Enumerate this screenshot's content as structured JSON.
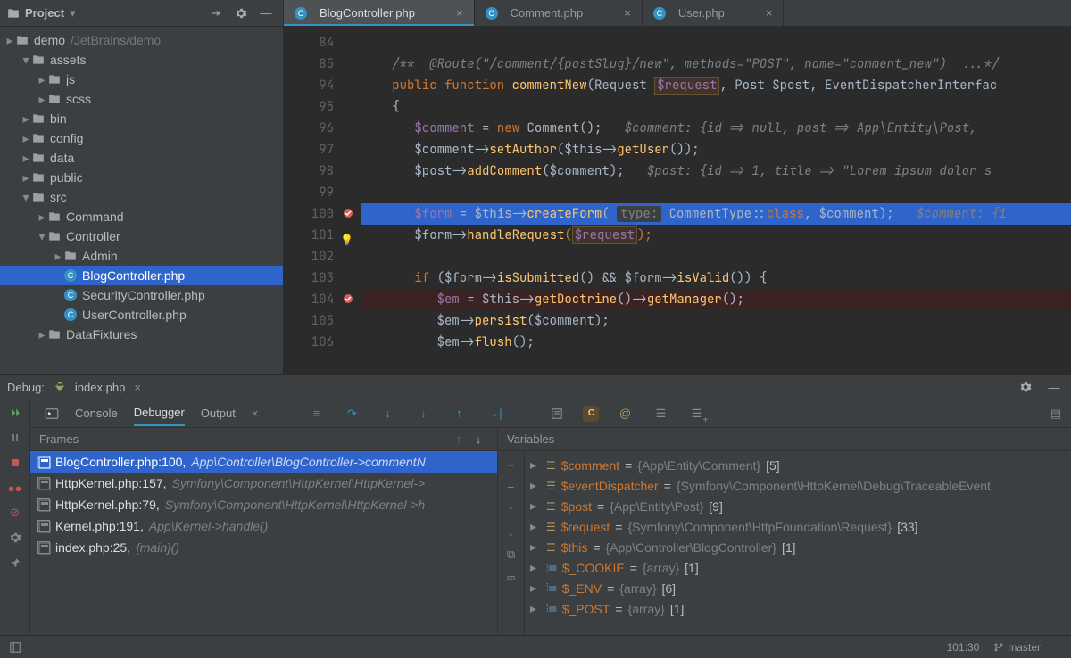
{
  "project": {
    "title": "Project",
    "root": {
      "name": "demo",
      "path": "/JetBrains/demo"
    },
    "tree": [
      {
        "type": "root",
        "name": "demo",
        "path": "/JetBrains/demo",
        "depth": 0
      },
      {
        "type": "folder",
        "name": "assets",
        "depth": 1,
        "expanded": true
      },
      {
        "type": "folder",
        "name": "js",
        "depth": 2,
        "expanded": false
      },
      {
        "type": "folder",
        "name": "scss",
        "depth": 2,
        "expanded": false
      },
      {
        "type": "folder",
        "name": "bin",
        "depth": 1,
        "expanded": false
      },
      {
        "type": "folder",
        "name": "config",
        "depth": 1,
        "expanded": false
      },
      {
        "type": "folder",
        "name": "data",
        "depth": 1,
        "expanded": false
      },
      {
        "type": "folder",
        "name": "public",
        "depth": 1,
        "expanded": false
      },
      {
        "type": "folder",
        "name": "src",
        "depth": 1,
        "expanded": true
      },
      {
        "type": "folder",
        "name": "Command",
        "depth": 2,
        "expanded": false
      },
      {
        "type": "folder",
        "name": "Controller",
        "depth": 2,
        "expanded": true
      },
      {
        "type": "folder",
        "name": "Admin",
        "depth": 3,
        "expanded": false
      },
      {
        "type": "file",
        "name": "BlogController.php",
        "depth": 3,
        "selected": true
      },
      {
        "type": "file",
        "name": "SecurityController.php",
        "depth": 3
      },
      {
        "type": "file",
        "name": "UserController.php",
        "depth": 3
      },
      {
        "type": "folder",
        "name": "DataFixtures",
        "depth": 2,
        "expanded": false
      }
    ]
  },
  "tabs": [
    {
      "label": "BlogController.php",
      "active": true
    },
    {
      "label": "Comment.php",
      "active": false
    },
    {
      "label": "User.php",
      "active": false
    }
  ],
  "editor": {
    "line_numbers": [
      "84",
      "85",
      "94",
      "95",
      "96",
      "97",
      "98",
      "99",
      "100",
      "101",
      "102",
      "103",
      "104",
      "105",
      "106"
    ],
    "breakpoints": {
      "100": true,
      "104": true
    },
    "bulb_line": "101",
    "highlighted_blue": "100",
    "highlighted_red": "104",
    "code": {
      "l85_comment": "/**  @Route(\"/comment/{postSlug}/new\", methods=\"POST\", name=\"comment_new\")  ...*/",
      "l94_sig_pre": "public function ",
      "l94_fn": "commentNew",
      "l94_params": "(Request ",
      "l94_p1": "$request",
      "l94_params2": ", Post $post, EventDispatcherInterfac",
      "l95": "{",
      "l96_var": "$comment",
      "l96_mid": " = ",
      "l96_new": "new ",
      "l96_cls": "Comment",
      "l96_tail": "();   ",
      "l96_hint": "$comment: {id => null, post => App\\Entity\\Post, ",
      "l97_pre": "$comment->",
      "l97_fn": "setAuthor",
      "l97_mid": "($this->",
      "l97_fn2": "getUser",
      "l97_tail": "());",
      "l98_pre": "$post->",
      "l98_fn": "addComment",
      "l98_mid": "($comment);   ",
      "l98_hint": "$post: {id => 1, title => \"Lorem ipsum dolor s",
      "l100_var": "$form",
      "l100_mid": " = $this->",
      "l100_fn": "createForm",
      "l100_open": "( ",
      "l100_hint": "type:",
      "l100_cls": " CommentType::",
      "l100_class_kw": "class",
      "l100_tail": ", $comment);   ",
      "l100_inline": "$comment: {i",
      "l101_pre": "$form->",
      "l101_fn": "handleRequest",
      "l101_open": "(",
      "l101_arg": "$request",
      "l101_close": ");",
      "l103_pre": "if ($form->",
      "l103_fn1": "isSubmitted",
      "l103_mid": "() && $form->",
      "l103_fn2": "isValid",
      "l103_tail": "()) {",
      "l104_var": "$em",
      "l104_mid": " = $this->",
      "l104_fn": "getDoctrine",
      "l104_mid2": "()->",
      "l104_fn2": "getManager",
      "l104_tail": "();",
      "l105_pre": "$em->",
      "l105_fn": "persist",
      "l105_tail": "($comment);",
      "l106_pre": "$em->",
      "l106_fn": "flush",
      "l106_tail": "();"
    }
  },
  "debug": {
    "title": "Debug:",
    "session": "index.php",
    "tabs": {
      "console": "Console",
      "debugger": "Debugger",
      "output": "Output"
    },
    "frames_title": "Frames",
    "frames": [
      {
        "loc": "BlogController.php:100,",
        "desc": "App\\Controller\\BlogController->commentN",
        "selected": true
      },
      {
        "loc": "HttpKernel.php:157,",
        "desc": "Symfony\\Component\\HttpKernel\\HttpKernel->"
      },
      {
        "loc": "HttpKernel.php:79,",
        "desc": "Symfony\\Component\\HttpKernel\\HttpKernel->h"
      },
      {
        "loc": "Kernel.php:191,",
        "desc": "App\\Kernel->handle()"
      },
      {
        "loc": "index.php:25,",
        "desc": "{main}()"
      }
    ],
    "vars_title": "Variables",
    "vars": [
      {
        "name": "$comment",
        "val": "{App\\Entity\\Comment}",
        "count": "[5]",
        "kind": "obj"
      },
      {
        "name": "$eventDispatcher",
        "val": "{Symfony\\Component\\HttpKernel\\Debug\\TraceableEvent",
        "count": "",
        "kind": "obj"
      },
      {
        "name": "$post",
        "val": "{App\\Entity\\Post}",
        "count": "[9]",
        "kind": "obj"
      },
      {
        "name": "$request",
        "val": "{Symfony\\Component\\HttpFoundation\\Request}",
        "count": "[33]",
        "kind": "obj"
      },
      {
        "name": "$this",
        "val": "{App\\Controller\\BlogController}",
        "count": "[1]",
        "kind": "obj"
      },
      {
        "name": "$_COOKIE",
        "val": "{array}",
        "count": "[1]",
        "kind": "sup"
      },
      {
        "name": "$_ENV",
        "val": "{array}",
        "count": "[6]",
        "kind": "sup"
      },
      {
        "name": "$_POST",
        "val": "{array}",
        "count": "[1]",
        "kind": "sup"
      }
    ]
  },
  "status": {
    "pos": "101:30",
    "branch": "master"
  }
}
